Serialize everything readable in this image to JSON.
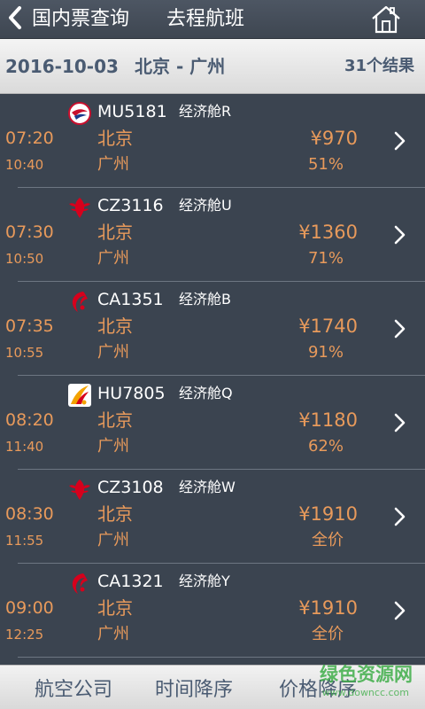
{
  "navbar": {
    "back_label": "国内票查询",
    "title": "去程航班",
    "back_icon": "chevron-left-icon",
    "home_icon": "home-icon"
  },
  "route": {
    "date": "2016-10-03",
    "cities": "北京 - 广州",
    "count": "31个结果"
  },
  "colors": {
    "background": "#3b4450",
    "accent_orange": "#e89a5b",
    "bar_text": "#4a5b72"
  },
  "flights": [
    {
      "logo": "china-eastern-logo",
      "flight_no": "MU5181",
      "cabin": "经济舱R",
      "dep_time": "07:20",
      "arr_time": "10:40",
      "dep_city": "北京",
      "arr_city": "广州",
      "price": "¥970",
      "discount": "51%"
    },
    {
      "logo": "china-southern-logo",
      "flight_no": "CZ3116",
      "cabin": "经济舱U",
      "dep_time": "07:30",
      "arr_time": "10:50",
      "dep_city": "北京",
      "arr_city": "广州",
      "price": "¥1360",
      "discount": "71%"
    },
    {
      "logo": "air-china-logo",
      "flight_no": "CA1351",
      "cabin": "经济舱B",
      "dep_time": "07:35",
      "arr_time": "10:55",
      "dep_city": "北京",
      "arr_city": "广州",
      "price": "¥1740",
      "discount": "91%"
    },
    {
      "logo": "hainan-airlines-logo",
      "flight_no": "HU7805",
      "cabin": "经济舱Q",
      "dep_time": "08:20",
      "arr_time": "11:40",
      "dep_city": "北京",
      "arr_city": "广州",
      "price": "¥1180",
      "discount": "62%"
    },
    {
      "logo": "china-southern-logo",
      "flight_no": "CZ3108",
      "cabin": "经济舱W",
      "dep_time": "08:30",
      "arr_time": "11:55",
      "dep_city": "北京",
      "arr_city": "广州",
      "price": "¥1910",
      "discount": "全价"
    },
    {
      "logo": "air-china-logo",
      "flight_no": "CA1321",
      "cabin": "经济舱Y",
      "dep_time": "09:00",
      "arr_time": "12:25",
      "dep_city": "北京",
      "arr_city": "广州",
      "price": "¥1910",
      "discount": "全价"
    }
  ],
  "sort_bar": {
    "airline": "航空公司",
    "time_desc": "时间降序",
    "price_desc": "价格降序"
  },
  "watermark": {
    "main": "绿色资源网",
    "sub": "www.downcc.com"
  }
}
